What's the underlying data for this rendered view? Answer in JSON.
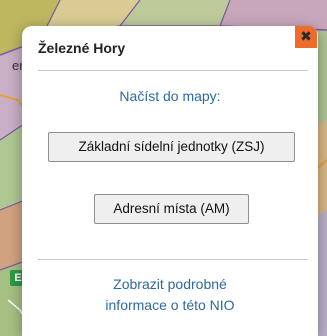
{
  "map": {
    "left_letter": "er",
    "badge": "E"
  },
  "popup": {
    "title": "Železné Hory",
    "close_glyph": "✖",
    "load_heading": "Načíst do mapy:",
    "buttons": {
      "zsj": "Základní sídelní jednotky (ZSJ)",
      "am": "Adresní místa (AM)"
    },
    "info_link": {
      "line1": "Zobrazit podrobné",
      "line2": "informace o této NIO"
    }
  },
  "colors": {
    "close_bg": "#ee6b2c",
    "link": "#2b6aa3",
    "map_base": "#c9c4b0"
  },
  "icons": {
    "close": "close-icon"
  }
}
